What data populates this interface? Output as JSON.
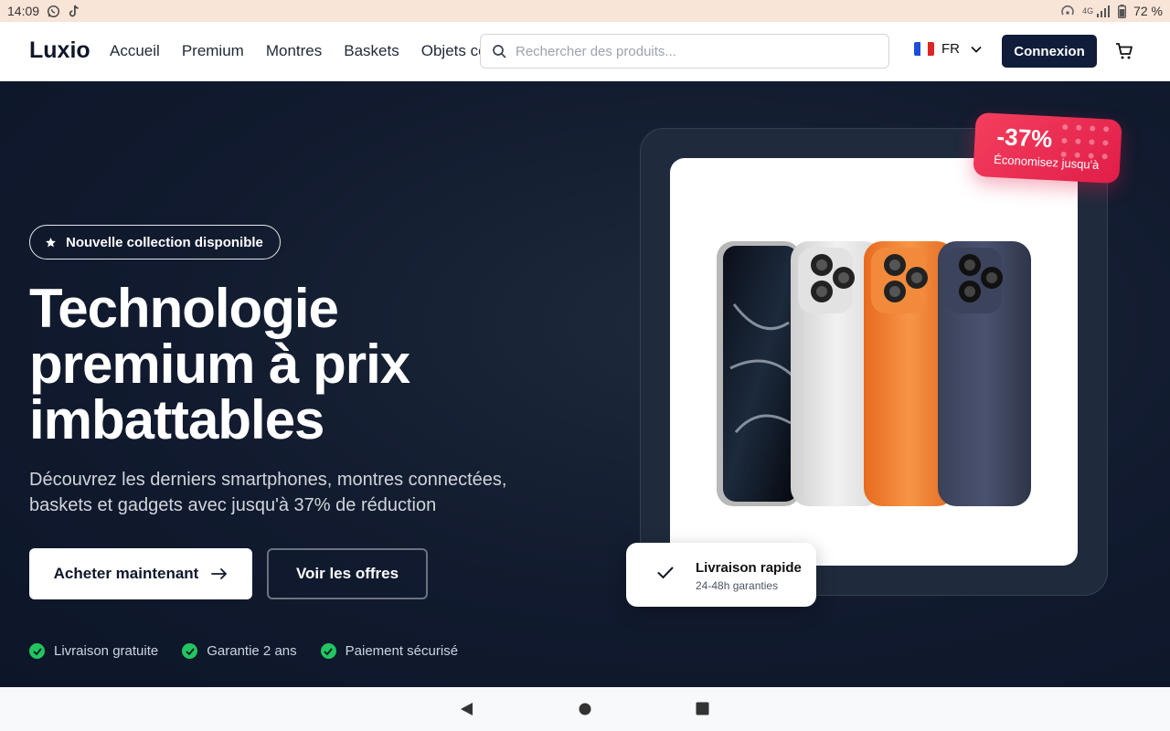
{
  "status": {
    "time": "14:09",
    "battery": "72 %",
    "network": "4G"
  },
  "header": {
    "logo": "Luxio",
    "nav": [
      "Accueil",
      "Premium",
      "Montres",
      "Baskets",
      "Objets connectés"
    ],
    "search_placeholder": "Rechercher des produits...",
    "lang": "FR",
    "login": "Connexion"
  },
  "hero": {
    "badge": "Nouvelle collection disponible",
    "title_lines": [
      "Technologie",
      "premium à prix",
      "imbattables"
    ],
    "subtitle_lines": [
      "Découvrez les derniers smartphones, montres connectées,",
      "baskets et gadgets avec jusqu'à 37% de réduction"
    ],
    "cta_primary": "Acheter maintenant",
    "cta_secondary": "Voir les offres",
    "features": [
      "Livraison gratuite",
      "Garantie 2 ans",
      "Paiement sécurisé"
    ]
  },
  "promo": {
    "discount": "-37%",
    "label": "Économisez jusqu'à"
  },
  "delivery": {
    "title": "Livraison rapide",
    "subtitle": "24-48h garanties"
  },
  "colors": {
    "accent": "#0f1c3a",
    "promo": "#e11d48",
    "success": "#22c55e",
    "hero_bg": "#111a2e"
  },
  "icons": [
    "whatsapp-icon",
    "tiktok-icon",
    "search-icon",
    "chevron-down-icon",
    "cart-icon",
    "star-icon",
    "arrow-right-icon",
    "check-circle-icon",
    "check-icon",
    "back-icon",
    "home-icon",
    "recents-icon"
  ]
}
